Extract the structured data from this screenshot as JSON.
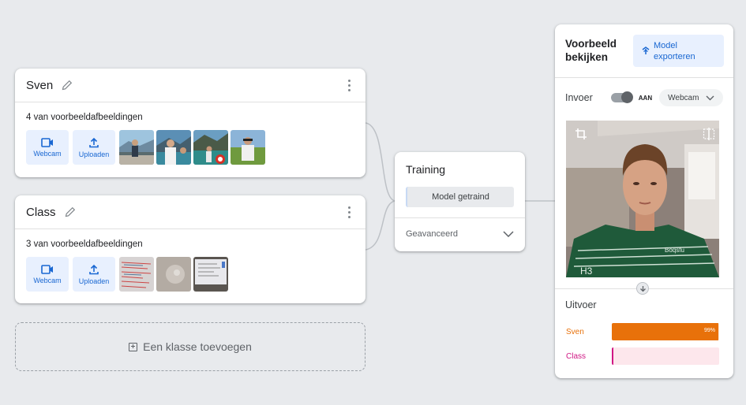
{
  "classes": [
    {
      "name": "Sven",
      "sample_count": "4 van voorbeeldafbeeldingen",
      "webcam_label": "Webcam",
      "upload_label": "Uploaden"
    },
    {
      "name": "Class",
      "sample_count": "3 van voorbeeldafbeeldingen",
      "webcam_label": "Webcam",
      "upload_label": "Uploaden"
    }
  ],
  "add_class_label": "Een klasse toevoegen",
  "training": {
    "title": "Training",
    "button_label": "Model getraind",
    "advanced_label": "Geavanceerd"
  },
  "preview": {
    "title": "Voorbeeld bekijken",
    "export_label": "Model exporteren",
    "input_label": "Invoer",
    "toggle_state": "AAN",
    "source": "Webcam",
    "output_label": "Uitvoer",
    "outputs": [
      {
        "name": "Sven",
        "percent_label": "99%",
        "confidence": 0.99,
        "color": "#e8710a",
        "track_color": "#fce8d6"
      },
      {
        "name": "Class",
        "percent_label": "",
        "confidence": 0.01,
        "color": "#d01884",
        "track_color": "#fde7ec"
      }
    ]
  },
  "icons": [
    "pencil-icon",
    "more-vert-icon",
    "videocam-icon",
    "upload-icon",
    "chevron-down-icon",
    "export-icon",
    "crop-icon",
    "flip-icon",
    "arrow-down-icon",
    "add-box-icon"
  ],
  "colors": {
    "accent_blue": "#1967d2",
    "button_bg": "#e8f0fe",
    "background": "#e8eaed"
  }
}
